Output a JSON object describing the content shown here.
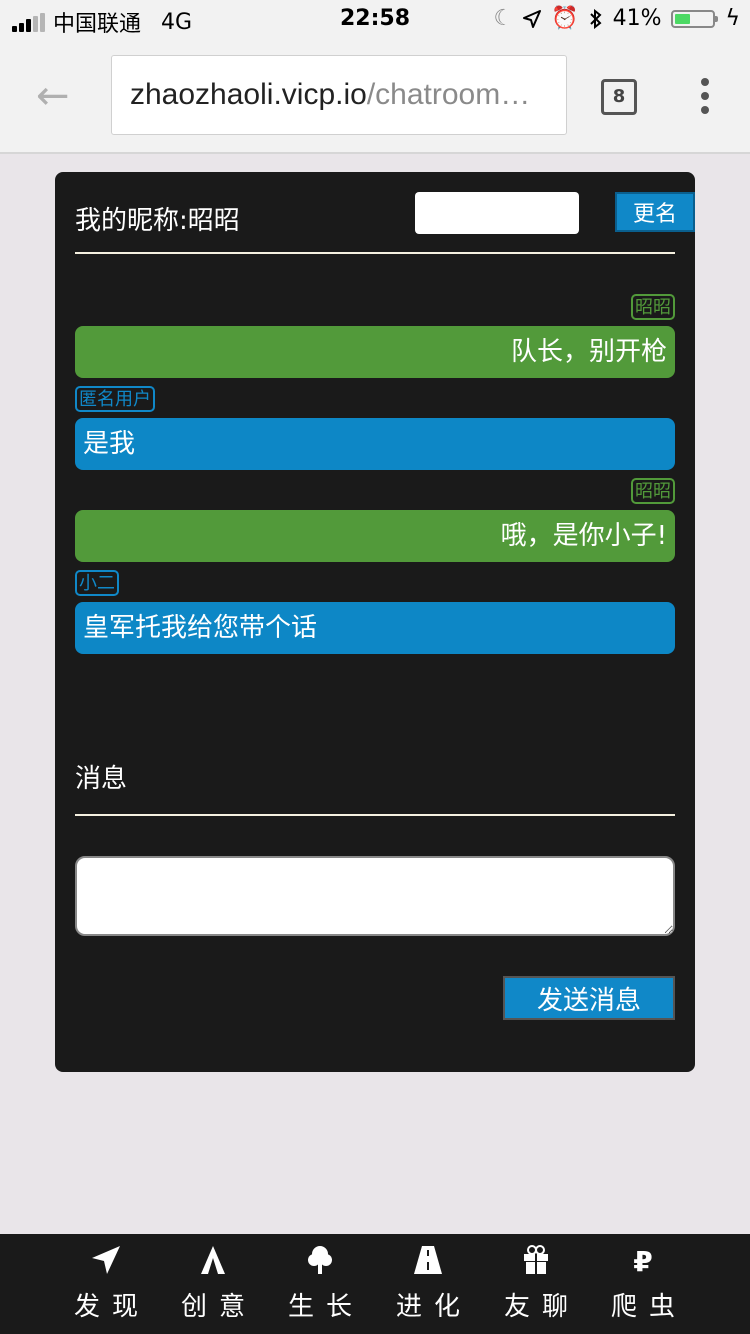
{
  "status_bar": {
    "carrier": "中国联通",
    "network": "4G",
    "time": "22:58",
    "battery_percent": "41%",
    "battery_level": 0.41
  },
  "browser": {
    "url_host": "zhaozhaoli.vicp.io",
    "url_path": "/chatroom…",
    "tab_count": "8"
  },
  "chat": {
    "nickname_label": "我的昵称:昭昭",
    "rename_button": "更名",
    "messages": [
      {
        "user": "昭昭",
        "text": "队长，别开枪",
        "self": true
      },
      {
        "user": "匿名用户",
        "text": "是我",
        "self": false
      },
      {
        "user": "昭昭",
        "text": "哦，是你小子!",
        "self": true
      },
      {
        "user": "小二",
        "text": "皇军托我给您带个话",
        "self": false
      }
    ],
    "message_label": "消息",
    "send_button": "发送消息"
  },
  "colors": {
    "self_bubble": "#529a3a",
    "other_bubble": "#0d87c6",
    "panel_bg": "#1a1a1a"
  },
  "bottom_nav": [
    {
      "label": "发现",
      "icon": "paper-plane-icon"
    },
    {
      "label": "创意",
      "icon": "tent-icon"
    },
    {
      "label": "生长",
      "icon": "tree-icon"
    },
    {
      "label": "进化",
      "icon": "road-icon"
    },
    {
      "label": "友聊",
      "icon": "gift-icon"
    },
    {
      "label": "爬虫",
      "icon": "ruble-icon"
    }
  ]
}
